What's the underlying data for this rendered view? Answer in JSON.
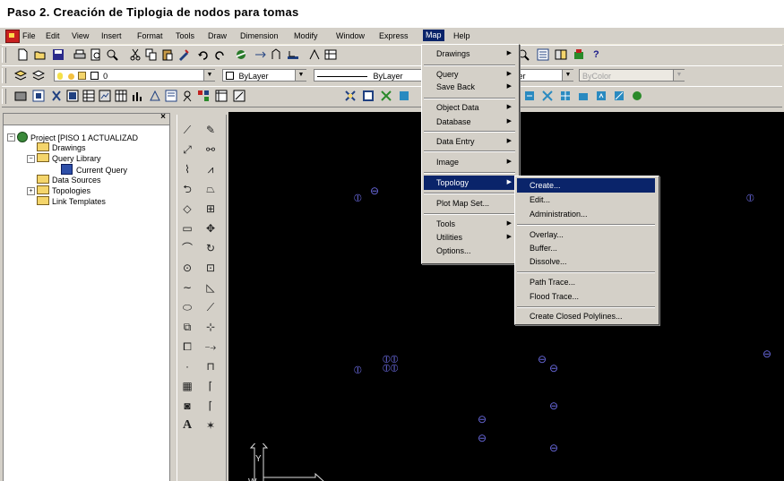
{
  "caption": "Paso 2. Creación de Tiplogia de nodos para tomas",
  "menubar": [
    "File",
    "Edit",
    "View",
    "Insert",
    "Format",
    "Tools",
    "Draw",
    "Dimension",
    "Modify",
    "Window",
    "Express",
    "Map",
    "Help"
  ],
  "layer_combo": "ByLayer",
  "linetype_combo": "ByLayer",
  "lineweight_combo": "yer",
  "color_combo": "ByColor",
  "layer_name": "0",
  "tree": {
    "project": "Project [PISO 1 ACTUALIZAD",
    "items": [
      "Drawings",
      "Query Library",
      "Current Query",
      "Data Sources",
      "Topologies",
      "Link Templates"
    ],
    "close": "×"
  },
  "map_menu": {
    "items": [
      "Drawings",
      "Query",
      "Save Back",
      "Object Data",
      "Database",
      "Data Entry",
      "Image",
      "Topology",
      "Plot Map Set...",
      "Tools",
      "Utilities",
      "Options..."
    ]
  },
  "topology_menu": {
    "items": [
      "Create...",
      "Edit...",
      "Administration...",
      "Overlay...",
      "Buffer...",
      "Dissolve...",
      "Path Trace...",
      "Flood Trace...",
      "Create Closed Polylines..."
    ]
  },
  "ucs": {
    "y": "Y",
    "x": "X",
    "w": "W"
  },
  "help_glyph": "?",
  "colors": {
    "highlight": "#0a246a",
    "canvas": "#000000",
    "node": "#6a6ae0",
    "chrome": "#d4d0c8"
  }
}
